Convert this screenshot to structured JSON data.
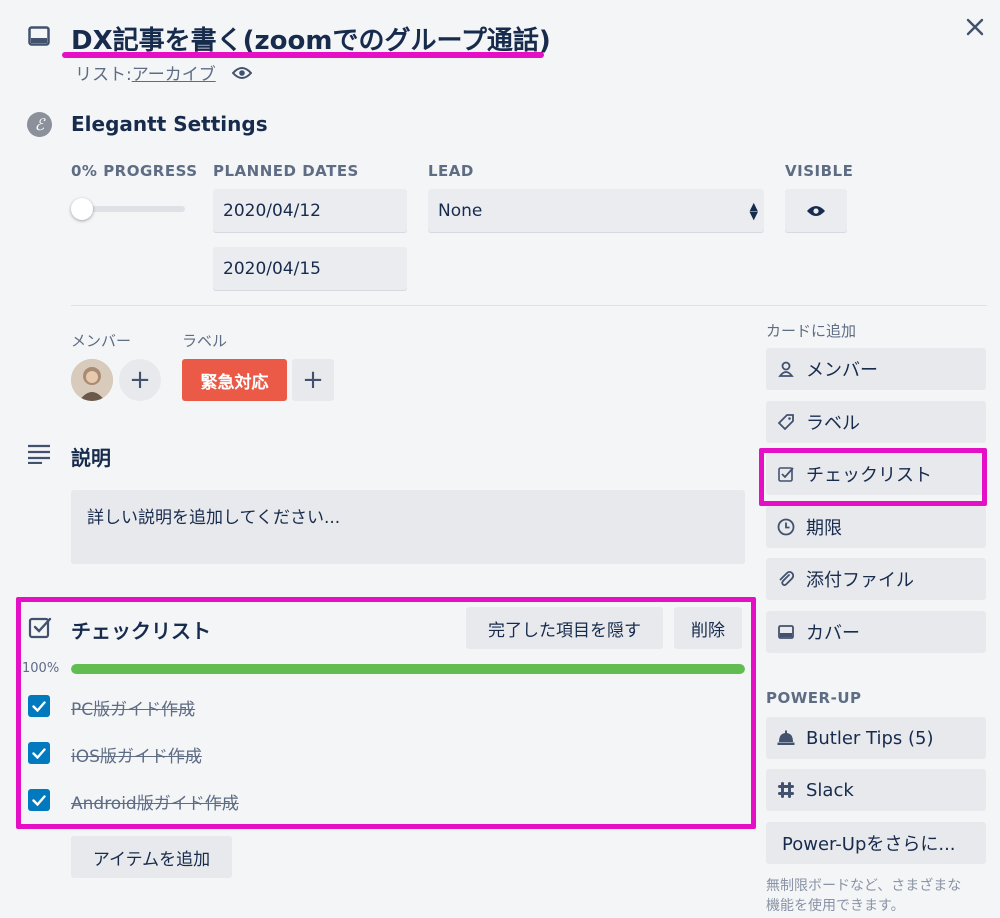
{
  "card": {
    "title": "DX記事を書く(zoomでのグループ通話)",
    "list_prefix": "リスト: ",
    "list_name": "アーカイブ"
  },
  "elegantt": {
    "title": "Elegantt Settings",
    "progress_label": "0% PROGRESS",
    "progress_value": 0,
    "planned_label": "PLANNED DATES",
    "start_date": "2020/04/12",
    "end_date": "2020/04/15",
    "lead_label": "LEAD",
    "lead_value": "None",
    "visible_label": "VISIBLE"
  },
  "members": {
    "label": "メンバー",
    "add": "+"
  },
  "labels": {
    "label": "ラベル",
    "chip": "緊急対応",
    "chip_color": "#eb5a46",
    "add": "+"
  },
  "description": {
    "title": "説明",
    "placeholder": "詳しい説明を追加してください..."
  },
  "checklist": {
    "title": "チェックリスト",
    "hide_button": "完了した項目を隠す",
    "delete_button": "削除",
    "percent": "100%",
    "progress_value": 1.0,
    "bar_color": "#61bd4f",
    "items": [
      {
        "text": "PC版ガイド作成",
        "checked": true
      },
      {
        "text": "iOS版ガイド作成",
        "checked": true
      },
      {
        "text": "Android版ガイド作成",
        "checked": true
      }
    ],
    "add_item": "アイテムを追加"
  },
  "sidebar": {
    "add_to_card": "カードに追加",
    "buttons": [
      {
        "label": "メンバー",
        "icon": "person-icon"
      },
      {
        "label": "ラベル",
        "icon": "tag-icon"
      },
      {
        "label": "チェックリスト",
        "icon": "checkbox-icon"
      },
      {
        "label": "期限",
        "icon": "clock-icon"
      },
      {
        "label": "添付ファイル",
        "icon": "paperclip-icon"
      },
      {
        "label": "カバー",
        "icon": "cover-icon"
      }
    ],
    "powerup_label": "POWER-UP",
    "powerups": [
      {
        "label": "Butler Tips (5)",
        "icon": "bell-icon"
      },
      {
        "label": "Slack",
        "icon": "slack-icon"
      },
      {
        "label": "Power-Upをさらに...",
        "icon": ""
      }
    ],
    "note_line1": "無制限ボードなど、さまざまな",
    "note_line2": "機能を使用できます。"
  },
  "colors": {
    "highlight": "#e50fc5",
    "checkbox": "#0079bf"
  }
}
